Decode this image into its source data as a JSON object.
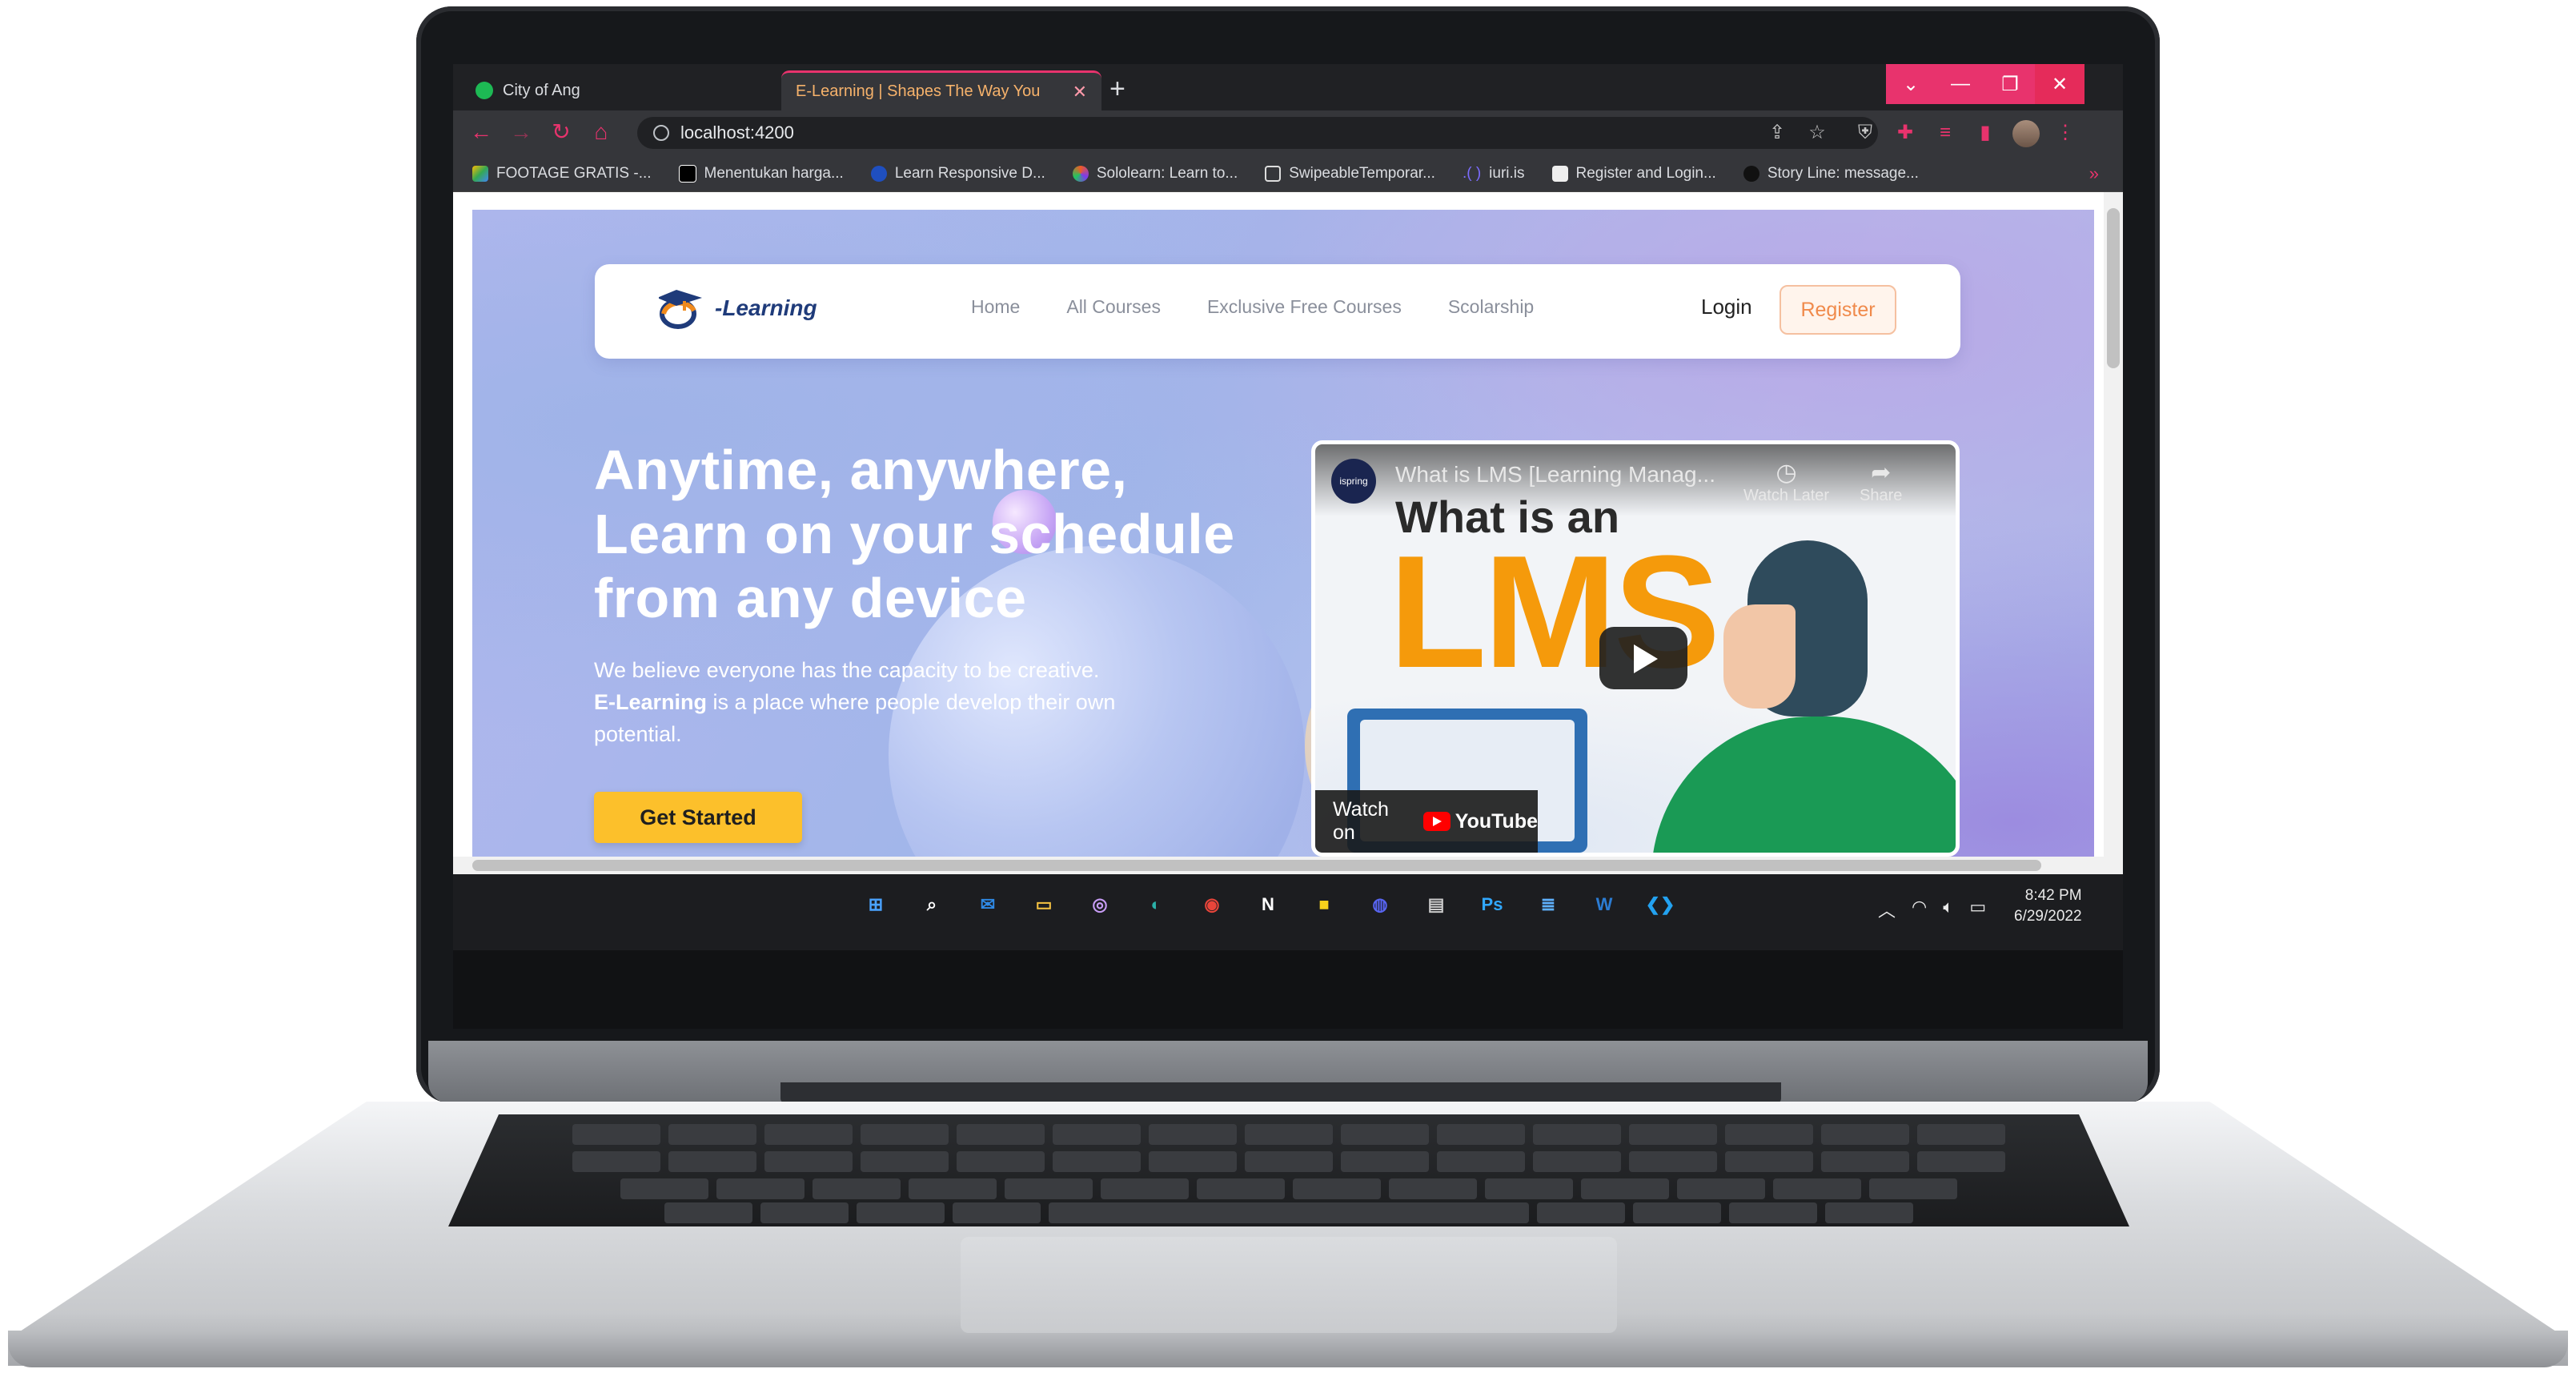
{
  "browser": {
    "tabs": [
      {
        "title": "City of Ang",
        "active": false
      },
      {
        "title": "E-Learning | Shapes The Way You",
        "active": true
      }
    ],
    "new_tab_label": "+",
    "url": "localhost:4200",
    "bookmarks": [
      {
        "label": "FOOTAGE GRATIS -...",
        "icon": "google-drive-icon"
      },
      {
        "label": "Menentukan harga...",
        "icon": "medium-icon"
      },
      {
        "label": "Learn Responsive D...",
        "icon": "codecademy-icon"
      },
      {
        "label": "Sololearn: Learn to...",
        "icon": "sololearn-icon"
      },
      {
        "label": "SwipeableTemporar...",
        "icon": "page-icon"
      },
      {
        "label": "iuri.is",
        "icon": "code-icon"
      },
      {
        "label": "Register and Login...",
        "icon": "page-icon"
      },
      {
        "label": "Story Line: message...",
        "icon": "github-icon"
      }
    ],
    "bookmarks_more": "»",
    "accent_color": "#e8336d"
  },
  "site": {
    "logo_text": "-Learning",
    "logo_letter": "e",
    "nav": [
      "Home",
      "All Courses",
      "Exclusive Free Courses",
      "Scolarship"
    ],
    "login_label": "Login",
    "register_label": "Register",
    "hero_title_lines": [
      "Anytime, anywhere,",
      "Learn on your schedule",
      "from any device"
    ],
    "hero_desc_line1": "We believe everyone has the capacity to be creative.",
    "hero_desc_brand": "E-Learning",
    "hero_desc_rest": " is a place where people develop their own potential.",
    "cta_label": "Get Started",
    "cta_color": "#fcc02b"
  },
  "video": {
    "channel": "ispring",
    "title": "What is LMS [Learning Manag...",
    "watch_later": "Watch Later",
    "share": "Share",
    "thumb_line1": "What is an",
    "thumb_line2": "LMS",
    "watch_on": "Watch on",
    "youtube": "YouTube"
  },
  "taskbar": {
    "apps": [
      {
        "name": "windows-start-icon",
        "glyph": "⊞",
        "color": "#4aa3ff"
      },
      {
        "name": "search-icon",
        "glyph": "⌕",
        "color": "#ffffff"
      },
      {
        "name": "mail-icon",
        "glyph": "✉",
        "color": "#2f8ae6"
      },
      {
        "name": "file-explorer-icon",
        "glyph": "▭",
        "color": "#f5c242"
      },
      {
        "name": "photos-icon",
        "glyph": "◎",
        "color": "#c79cf5"
      },
      {
        "name": "edge-icon",
        "glyph": "◐",
        "color": "#2bb0a8"
      },
      {
        "name": "chrome-icon",
        "glyph": "◉",
        "color": "#e9453a"
      },
      {
        "name": "notion-icon",
        "glyph": "N",
        "color": "#ffffff"
      },
      {
        "name": "sticky-notes-icon",
        "glyph": "■",
        "color": "#f7d21c"
      },
      {
        "name": "discord-icon",
        "glyph": "◍",
        "color": "#5865f2"
      },
      {
        "name": "terminal-icon",
        "glyph": "▤",
        "color": "#cccccc"
      },
      {
        "name": "photoshop-icon",
        "glyph": "Ps",
        "color": "#31a8ff"
      },
      {
        "name": "notepad-icon",
        "glyph": "≣",
        "color": "#5fb2ff"
      },
      {
        "name": "word-icon",
        "glyph": "W",
        "color": "#2b7cd3"
      },
      {
        "name": "vscode-icon",
        "glyph": "❮❯",
        "color": "#23a2f0"
      }
    ],
    "time": "8:42 PM",
    "date": "6/29/2022"
  }
}
